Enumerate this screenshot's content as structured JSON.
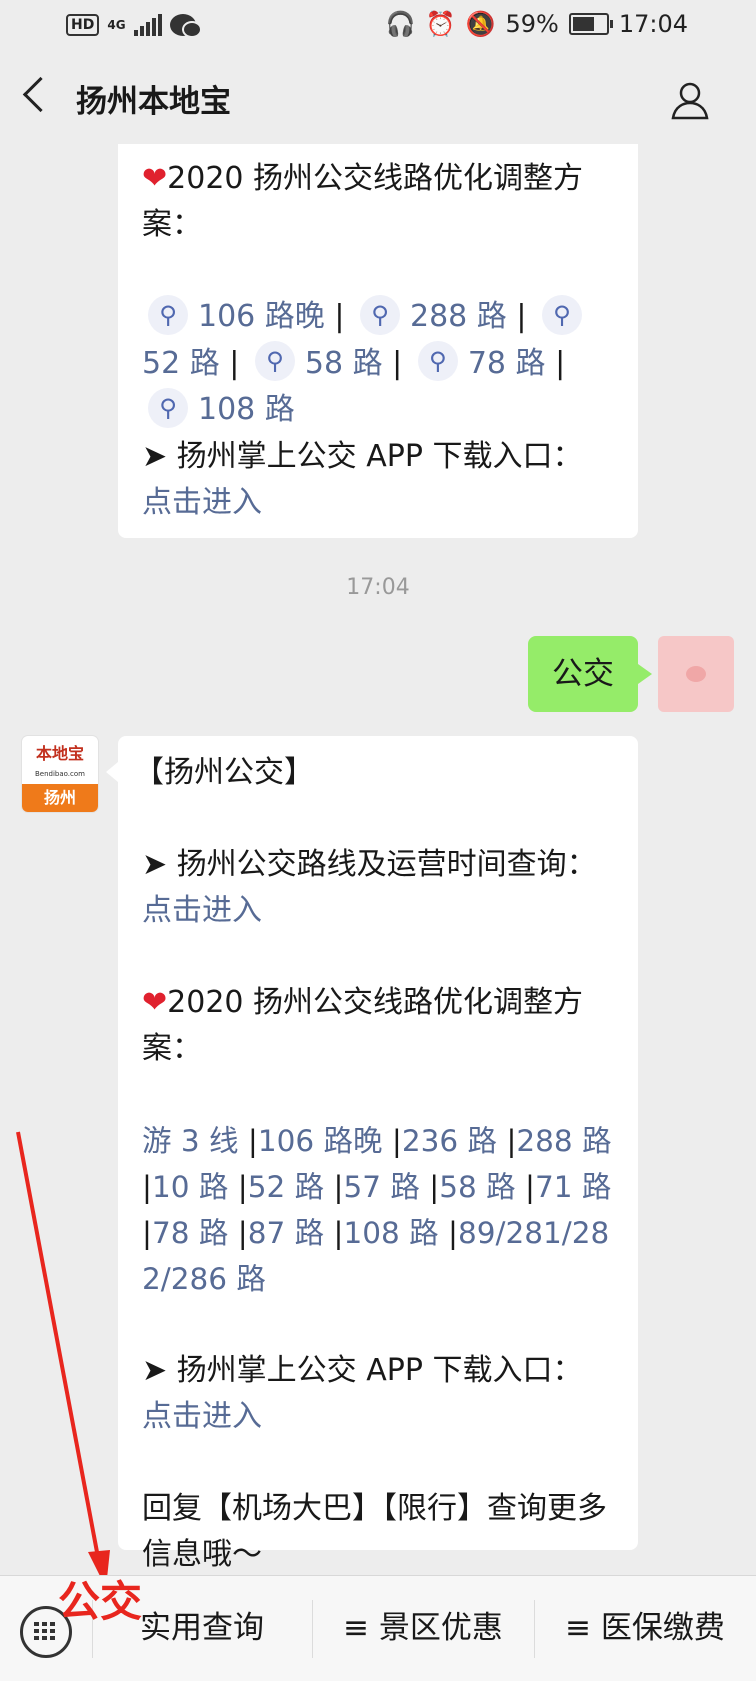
{
  "status_bar": {
    "hd": "HD",
    "network": "4G",
    "battery_pct": "59%",
    "time": "17:04"
  },
  "header": {
    "title": "扬州本地宝"
  },
  "prev_message": {
    "heading": "2020 扬州公交线路优化调整方案：",
    "mini_links": [
      "106 路晚",
      "288 路",
      "52 路",
      "58 路",
      "78 路",
      "108 路"
    ],
    "app_text": "➤ 扬州掌上公交 APP 下载入口：",
    "app_link": "点击进入"
  },
  "timestamp": "17:04",
  "user_message": {
    "text": "公交"
  },
  "bot_avatar": {
    "top": "本地宝",
    "sub": "Bendibao.com",
    "city": "扬州"
  },
  "reply": {
    "title": "【扬州公交】",
    "query_text": "➤ 扬州公交路线及运营时间查询：",
    "query_link": "点击进入",
    "heading": "2020 扬州公交线路优化调整方案：",
    "routes": [
      "游 3 线",
      "106 路晚",
      "236 路",
      "288 路",
      "10 路",
      "52 路",
      "57 路",
      "58 路",
      "71 路",
      "78 路",
      "87 路",
      "108 路",
      "89/281/282/286 路"
    ],
    "app_text": "➤ 扬州掌上公交 APP 下载入口：",
    "app_link": "点击进入",
    "footer": "回复【机场大巴】【限行】查询更多信息哦～"
  },
  "annotation": {
    "text": "公交",
    "color": "#e8261e"
  },
  "bottom_menu": [
    "实用查询",
    "≡ 景区优惠",
    "≡ 医保缴费"
  ]
}
